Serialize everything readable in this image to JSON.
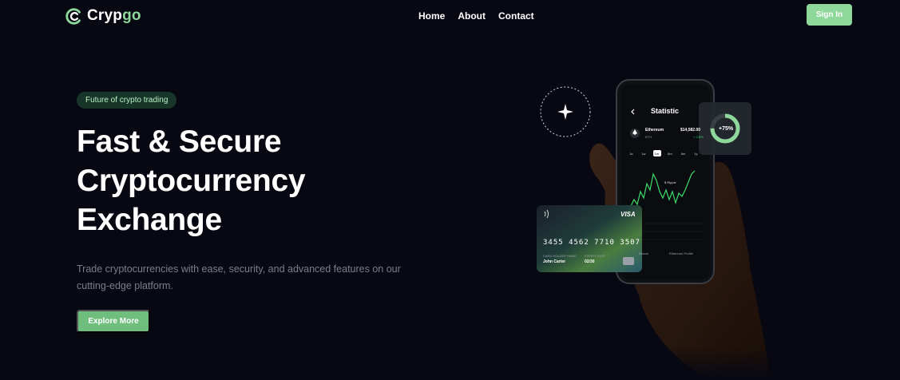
{
  "brand": {
    "name_main": "Cryp",
    "name_accent": "go"
  },
  "nav": {
    "items": [
      "Home",
      "About",
      "Contact"
    ],
    "signin_label": "Sign In"
  },
  "hero": {
    "tag": "Future of crypto trading",
    "headline": [
      "Fast & Secure",
      "Cryptocurrency",
      "Exchange"
    ],
    "subtext": "Trade cryptocurrencies with ease, security, and advanced features on our cutting-edge platform.",
    "cta_label": "Explore More"
  },
  "phone": {
    "title": "Statistic",
    "coin_name": "Ethereum",
    "coin_symbol": "ETH",
    "coin_price": "$14,582.00",
    "coin_change": "+ 2.8%",
    "timeframes": [
      "1d",
      "1w",
      "1m",
      "6m",
      "6m",
      "1y"
    ],
    "active_timeframe": "1m",
    "chart_tag": "$ Ripple",
    "footer_left": "Bitcoin",
    "footer_right": "Ethereum Profile"
  },
  "badge": {
    "percent": "+75%"
  },
  "card": {
    "brand": "VISA",
    "number": "3455 4562 7710 3507",
    "holder_label": "CARD HOLDER NAME",
    "holder": "John Carter",
    "expiry_label": "EXPIRY DATE",
    "expiry": "02/30"
  },
  "colors": {
    "accent": "#8fd89c",
    "background": "#070812",
    "chart_line": "#3ddc6b"
  },
  "icons": [
    "logo-icon",
    "sparkle-icon",
    "back-arrow-icon",
    "ethereum-icon",
    "contactless-icon",
    "chip-icon"
  ]
}
